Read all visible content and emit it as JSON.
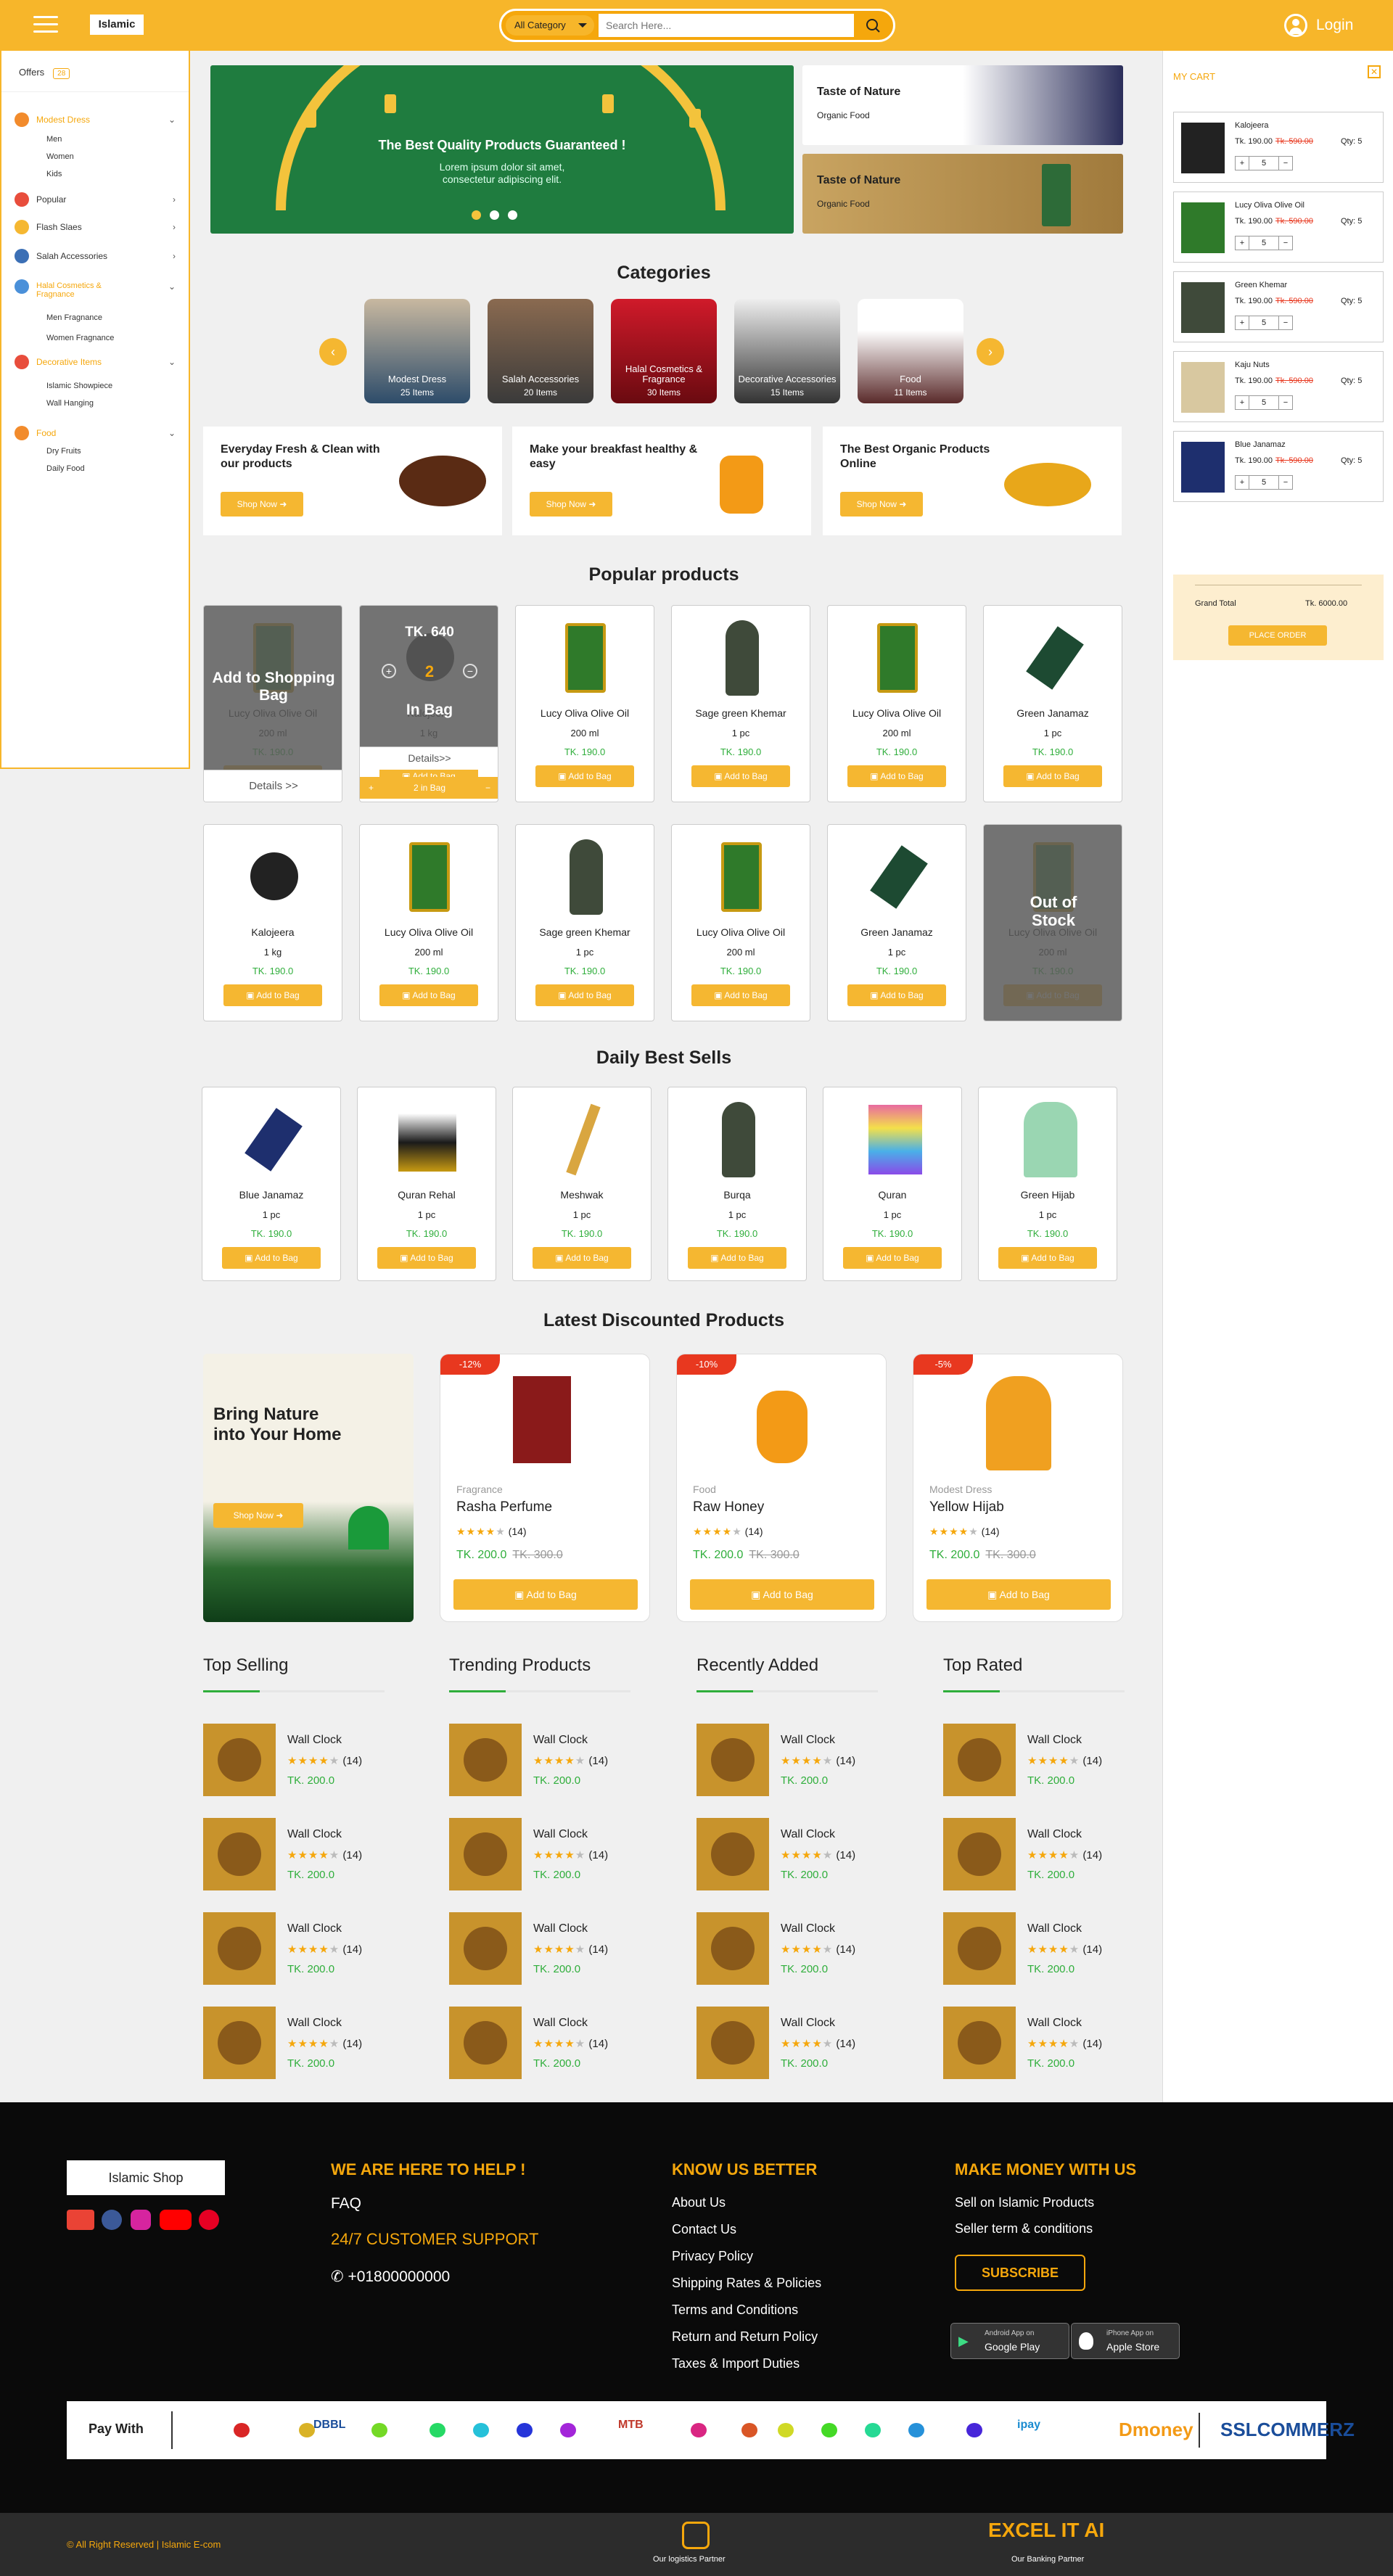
{
  "header": {
    "menu_icon": "hamburger-icon",
    "logo": "Islamic",
    "category": "All Category",
    "search_placeholder": "Search Here...",
    "login": "Login"
  },
  "sidebar": {
    "offers": "Offers",
    "offers_badge": "28",
    "items": [
      {
        "label": "Modest Dress",
        "active": true,
        "subs": [
          "Men",
          "Women",
          "Kids"
        ]
      },
      {
        "label": "Popular"
      },
      {
        "label": "Flash Slaes"
      },
      {
        "label": "Salah Accessories"
      },
      {
        "label": "Halal Cosmetics & Fragnance",
        "active": true,
        "subs": [
          "Men Fragnance",
          "Women Fragnance"
        ]
      },
      {
        "label": "Decorative Items",
        "active": true,
        "subs": [
          "Islamic Showpiece",
          "Wall Hanging"
        ]
      },
      {
        "label": "Food",
        "active": true,
        "subs": [
          "Dry Fruits",
          "Daily Food"
        ]
      }
    ]
  },
  "hero": {
    "title": "The Best Quality Products Guaranteed !",
    "text1": "Lorem ipsum dolor sit amet,",
    "text2": "consectetur adipiscing elit.",
    "side": [
      {
        "title": "Taste of Nature",
        "sub": "Organic Food"
      },
      {
        "title": "Taste of Nature",
        "sub": "Organic Food"
      }
    ]
  },
  "categories": {
    "title": "Categories",
    "items": [
      {
        "name": "Modest Dress",
        "count": "25 Items"
      },
      {
        "name": "Salah Accessories",
        "count": "20 Items"
      },
      {
        "name": "Halal Cosmetics & Fragrance",
        "count": "30 Items"
      },
      {
        "name": "Decorative Accessories",
        "count": "15 Items"
      },
      {
        "name": "Food",
        "count": "11 Items"
      }
    ]
  },
  "promos": [
    {
      "title": "Everyday Fresh & Clean with our products",
      "btn": "Shop Now"
    },
    {
      "title": "Make your breakfast healthy & easy",
      "btn": "Shop Now"
    },
    {
      "title": "The Best Organic Products Online",
      "btn": "Shop Now"
    }
  ],
  "popular": {
    "title": "Popular products",
    "add": "Add to Bag",
    "row1": [
      {
        "name": "Lucy Oliva Olive Oil",
        "qty": "200 ml",
        "price": "TK. 190.0",
        "overlay": "Add to Shopping Bag",
        "details": "Details >>"
      },
      {
        "name": "Kalojeera",
        "qty": "1 kg",
        "price": "TK. 190.0",
        "overlay_price": "TK. 640",
        "overlay_count": "2",
        "overlay": "In Bag",
        "details": "Details>>",
        "inbag": "2 in Bag"
      },
      {
        "name": "Lucy Oliva Olive Oil",
        "qty": "200 ml",
        "price": "TK. 190.0"
      },
      {
        "name": "Sage green Khemar",
        "qty": "1 pc",
        "price": "TK. 190.0"
      },
      {
        "name": "Lucy Oliva Olive Oil",
        "qty": "200 ml",
        "price": "TK. 190.0"
      },
      {
        "name": "Green Janamaz",
        "qty": "1 pc",
        "price": "TK. 190.0"
      }
    ],
    "row2": [
      {
        "name": "Kalojeera",
        "qty": "1 kg",
        "price": "TK. 190.0"
      },
      {
        "name": "Lucy Oliva Olive Oil",
        "qty": "200 ml",
        "price": "TK. 190.0"
      },
      {
        "name": "Sage green Khemar",
        "qty": "1 pc",
        "price": "TK. 190.0"
      },
      {
        "name": "Lucy Oliva Olive Oil",
        "qty": "200 ml",
        "price": "TK. 190.0"
      },
      {
        "name": "Green Janamaz",
        "qty": "1 pc",
        "price": "TK. 190.0"
      },
      {
        "name": "Lucy Oliva Olive Oil",
        "qty": "200 ml",
        "price": "TK. 190.0",
        "overlay": "Out of Stock"
      }
    ]
  },
  "daily": {
    "title": "Daily Best Sells",
    "items": [
      {
        "name": "Blue Janamaz",
        "qty": "1 pc",
        "price": "TK. 190.0"
      },
      {
        "name": "Quran Rehal",
        "qty": "1 pc",
        "price": "TK. 190.0"
      },
      {
        "name": "Meshwak",
        "qty": "1 pc",
        "price": "TK. 190.0"
      },
      {
        "name": "Burqa",
        "qty": "1 pc",
        "price": "TK. 190.0"
      },
      {
        "name": "Quran",
        "qty": "1 pc",
        "price": "TK. 190.0"
      },
      {
        "name": "Green Hijab",
        "qty": "1 pc",
        "price": "TK. 190.0"
      }
    ]
  },
  "discount": {
    "title": "Latest Discounted Products",
    "banner_title": "Bring Nature into Your Home",
    "banner_btn": "Shop Now",
    "items": [
      {
        "tag": "-12%",
        "cat": "Fragrance",
        "name": "Rasha Perfume",
        "reviews": "(14)",
        "price": "TK. 200.0",
        "old": "TK. 300.0",
        "btn": "Add to Bag"
      },
      {
        "tag": "-10%",
        "cat": "Food",
        "name": "Raw Honey",
        "reviews": "(14)",
        "price": "TK. 200.0",
        "old": "TK. 300.0",
        "btn": "Add to Bag"
      },
      {
        "tag": "-5%",
        "cat": "Modest Dress",
        "name": "Yellow Hijab",
        "reviews": "(14)",
        "price": "TK. 200.0",
        "old": "TK. 300.0",
        "btn": "Add to Bag"
      }
    ]
  },
  "lists": {
    "titles": [
      "Top Selling",
      "Trending Products",
      "Recently Added",
      "Top Rated"
    ],
    "item": {
      "name": "Wall Clock",
      "reviews": "(14)",
      "price": "TK. 200.0"
    }
  },
  "cart": {
    "title": "MY CART",
    "items": [
      {
        "name": "Kalojeera",
        "price": "Tk. 190.00",
        "old": "Tk. 590.00",
        "qty": "Qty: 5",
        "count": "5"
      },
      {
        "name": "Lucy Oliva Olive Oil",
        "price": "Tk. 190.00",
        "old": "Tk. 590.00",
        "qty": "Qty: 5",
        "count": "5"
      },
      {
        "name": "Green Khemar",
        "price": "Tk. 190.00",
        "old": "Tk. 590.00",
        "qty": "Qty: 5",
        "count": "5"
      },
      {
        "name": "Kaju Nuts",
        "price": "Tk. 190.00",
        "old": "Tk. 590.00",
        "qty": "Qty: 5",
        "count": "5"
      },
      {
        "name": "Blue Janamaz",
        "price": "Tk. 190.00",
        "old": "Tk. 590.00",
        "qty": "Qty: 5",
        "count": "5"
      }
    ],
    "grand_label": "Grand Total",
    "grand": "Tk. 6000.00",
    "order": "PLACE ORDER"
  },
  "footer": {
    "shop": "Islamic Shop",
    "help": "WE ARE HERE TO HELP !",
    "faq": "FAQ",
    "support": "24/7 CUSTOMER SUPPORT",
    "phone": "+01800000000",
    "know": "KNOW US BETTER",
    "know_links": [
      "About Us",
      "Contact Us",
      "Privacy Policy",
      "Shipping Rates & Policies",
      "Terms and Conditions",
      "Return and Return Policy",
      "Taxes & Import Duties"
    ],
    "money": "MAKE MONEY WITH US",
    "money_links": [
      "Sell on Islamic Products",
      "Seller term & conditions"
    ],
    "subscribe": "SUBSCRIBE",
    "android_small": "Android App on",
    "android": "Google Play",
    "iphone_small": "iPhone App on",
    "iphone": "Apple Store",
    "pay": "Pay With",
    "pay_logos": [
      "DBBL",
      "MTB",
      "ipay",
      "Dmoney",
      "SSLCOMMERZ"
    ],
    "copyright": "© All Right Reserved | Islamic E-com",
    "logistics": "Our logistics Partner",
    "partner": "EXCEL IT AI",
    "banking": "Our Banking Partner"
  }
}
